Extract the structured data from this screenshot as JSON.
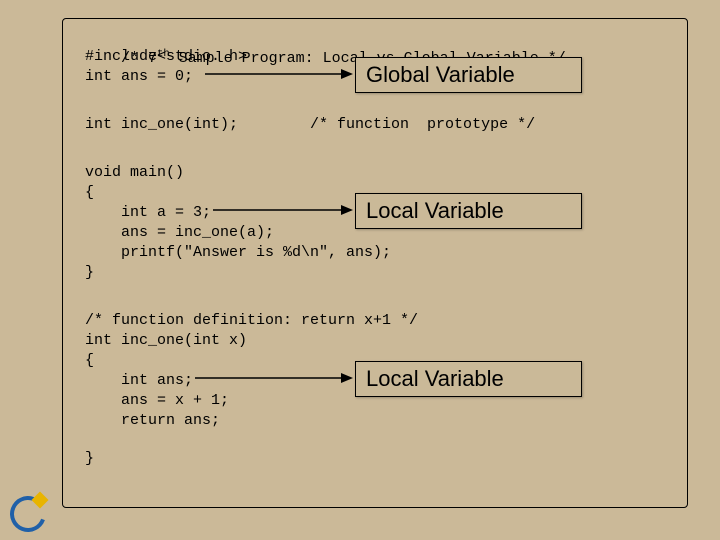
{
  "code": {
    "l1a": "/* 7",
    "l1sup": "th",
    "l1b": " Sample Program: Local vs Global Variable */",
    "l2": "#include<stdio. h>",
    "l3": "int ans = 0;",
    "l5": "int inc_one(int);        /* function  prototype */",
    "l7": "void main()",
    "l8": "{",
    "l9": "    int a = 3;",
    "l10": "    ans = inc_one(a);",
    "l11": "    printf(\"Answer is %d\\n\", ans);",
    "l12": "}",
    "l14": "/* function definition: return x+1 */",
    "l15": "int inc_one(int x)",
    "l16": "{",
    "l17": "    int ans;",
    "l18": "    ans = x + 1;",
    "l19": "    return ans;",
    "l20": "}"
  },
  "labels": {
    "global": "Global Variable",
    "local1": "Local Variable",
    "local2": "Local Variable"
  }
}
